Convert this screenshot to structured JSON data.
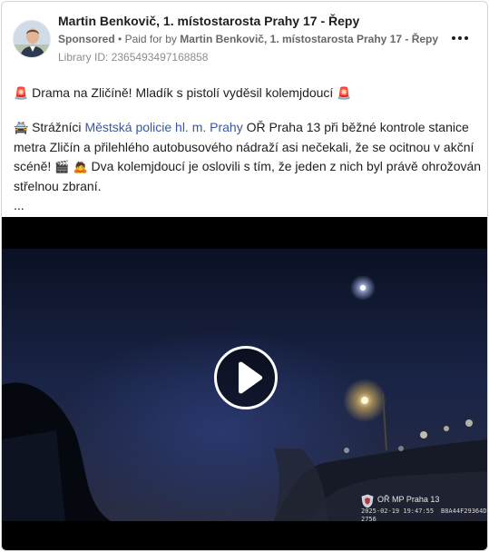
{
  "post": {
    "page_name": "Martin Benkovič, 1. místostarosta Prahy 17 - Řepy",
    "sponsored_label": "Sponsored",
    "separator": "•",
    "paid_for_prefix": "Paid for by",
    "paid_for_by": "Martin Benkovič, 1. místostarosta Prahy 17 - Řepy",
    "library_id": "Library ID: 2365493497168858",
    "headline_emoji_left": "🚨",
    "headline": "Drama na Zličíně! Mladík s pistolí vyděsil kolemjdoucí",
    "headline_emoji_right": "🚨",
    "paragraph": {
      "lead_emoji": "🚔",
      "part1": "Strážníci",
      "link": "Městská policie hl. m. Prahy",
      "part2": "OŘ Praha 13 při běžné kontrole stanice",
      "line2": "metra Zličín a přilehlého autobusového nádraží asi nečekali, že se ocitnou v akční",
      "line3_start": "scéně!",
      "line3_emojis": "🎬 🙇",
      "line3_end": "Dva kolemjdoucí je oslovili s tím, že jeden z nich byl právě ohrožován",
      "line4": "střelnou zbraní.",
      "ellipsis": "..."
    }
  },
  "video": {
    "watermark": "OŘ MP Praha 13",
    "timestamp": "2025-02-19 19:47:55",
    "device_id": "B8A44F29364D",
    "frame_no": "2756"
  },
  "colors": {
    "link": "#385898",
    "text": "#1c1e21",
    "meta": "#65676b"
  }
}
